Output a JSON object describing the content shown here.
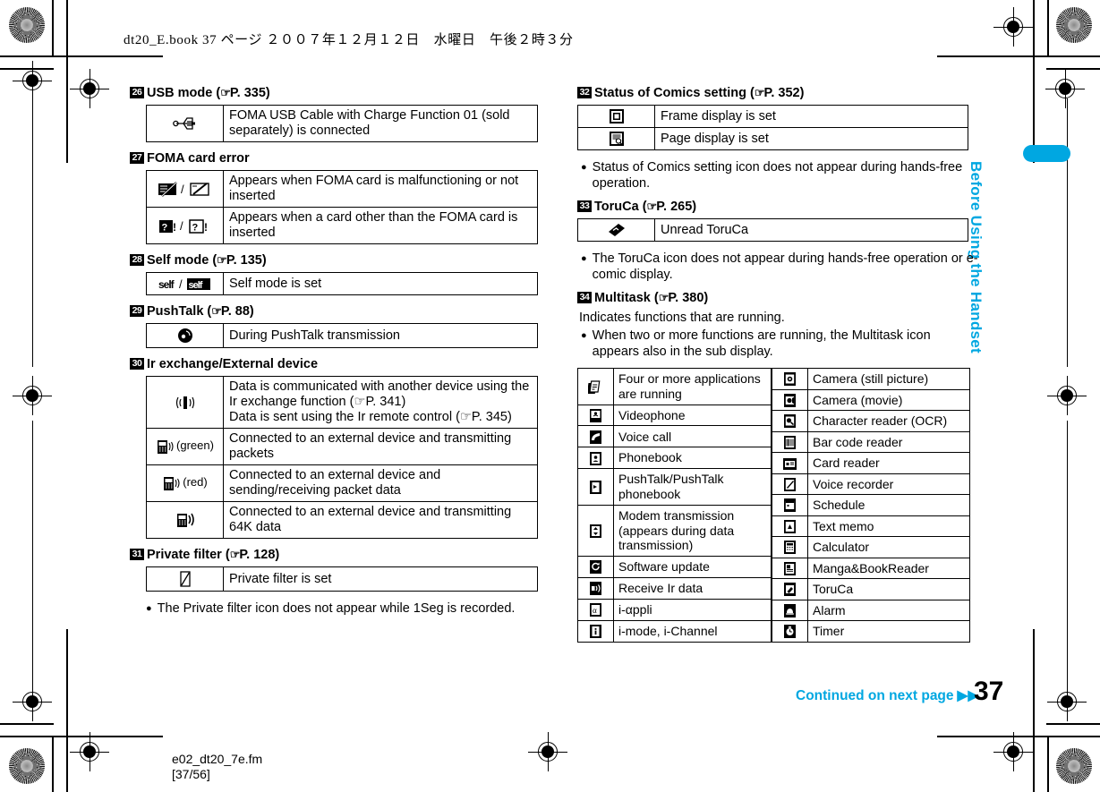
{
  "slug": {
    "header": "dt20_E.book  37 ページ  ２００７年１２月１２日　水曜日　午後２時３分",
    "footer_file": "e02_dt20_7e.fm",
    "footer_range": "[37/56]"
  },
  "side_tab": {
    "title": "Before Using the Handset",
    "color": "#00a7e1"
  },
  "footer": {
    "continued": "Continued on next page",
    "arrows": "▶▶",
    "page_number": "37"
  },
  "left_column": {
    "sections": [
      {
        "number": "26",
        "title": "USB mode",
        "ref": "P. 335",
        "rows": [
          {
            "icon": "usb-icon",
            "text": "FOMA USB Cable with Charge Function 01 (sold separately) is connected"
          }
        ]
      },
      {
        "number": "27",
        "title": "FOMA card error",
        "ref": "",
        "rows": [
          {
            "icon": "foma-card-error-icon",
            "text": "Appears when FOMA card is malfunctioning or not inserted"
          },
          {
            "icon": "other-card-icon",
            "text": "Appears when a card other than the FOMA card is inserted"
          }
        ]
      },
      {
        "number": "28",
        "title": "Self mode",
        "ref": "P. 135",
        "rows": [
          {
            "icon": "self-mode-icon",
            "text": "Self mode is set"
          }
        ]
      },
      {
        "number": "29",
        "title": "PushTalk",
        "ref": "P. 88",
        "rows": [
          {
            "icon": "pushtalk-icon",
            "text": "During PushTalk transmission"
          }
        ]
      },
      {
        "number": "30",
        "title": "Ir exchange/External device",
        "ref": "",
        "rows": [
          {
            "icon": "ir-exchange-icon",
            "text": "Data is communicated with another device using the Ir exchange function (☞P. 341)\nData is sent using the Ir remote control (☞P. 345)"
          },
          {
            "icon": "external-device-green-icon",
            "icon_label": "(green)",
            "text": "Connected to an external device and transmitting packets"
          },
          {
            "icon": "external-device-red-icon",
            "icon_label": "(red)",
            "text": "Connected to an external device and sending/receiving packet data"
          },
          {
            "icon": "external-device-64k-icon",
            "text": "Connected to an external device and transmitting 64K data"
          }
        ]
      },
      {
        "number": "31",
        "title": "Private filter",
        "ref": "P. 128",
        "rows": [
          {
            "icon": "private-filter-icon",
            "text": "Private filter is set"
          }
        ],
        "note": "The Private filter icon does not appear while 1Seg is recorded."
      }
    ]
  },
  "right_column": {
    "sections": [
      {
        "number": "32",
        "title": "Status of Comics setting",
        "ref": "P. 352",
        "rows": [
          {
            "icon": "frame-display-icon",
            "text": "Frame display is set"
          },
          {
            "icon": "page-display-icon",
            "text": "Page display is set"
          }
        ],
        "note": "Status of Comics setting icon does not appear during hands-free operation."
      },
      {
        "number": "33",
        "title": "ToruCa",
        "ref": "P. 265",
        "rows": [
          {
            "icon": "toruca-unread-icon",
            "text": "Unread ToruCa"
          }
        ],
        "note": "The ToruCa icon does not appear during hands-free operation or e-comic display."
      },
      {
        "number": "34",
        "title": "Multitask",
        "ref": "P. 380",
        "intro": "Indicates functions that are running.",
        "note": "When two or more functions are running, the Multitask icon appears also in the sub display."
      }
    ],
    "multitask_left": [
      {
        "icon": "four-apps-icon",
        "text": "Four or more applications are running"
      },
      {
        "icon": "videophone-icon",
        "text": "Videophone"
      },
      {
        "icon": "voice-call-icon",
        "text": "Voice call"
      },
      {
        "icon": "phonebook-icon",
        "text": "Phonebook"
      },
      {
        "icon": "pushtalk-book-icon",
        "text": "PushTalk/PushTalk phonebook"
      },
      {
        "icon": "modem-icon",
        "text": "Modem transmission (appears during data transmission)"
      },
      {
        "icon": "software-update-icon",
        "text": "Software update"
      },
      {
        "icon": "receive-ir-icon",
        "text": "Receive Ir data"
      },
      {
        "icon": "i-appli-icon",
        "text": "i-αppli"
      },
      {
        "icon": "i-mode-icon",
        "text": "i-mode, i-Channel"
      }
    ],
    "multitask_right": [
      {
        "icon": "camera-still-icon",
        "text": "Camera (still picture)"
      },
      {
        "icon": "camera-movie-icon",
        "text": "Camera (movie)"
      },
      {
        "icon": "ocr-icon",
        "text": "Character reader (OCR)"
      },
      {
        "icon": "barcode-icon",
        "text": "Bar code reader"
      },
      {
        "icon": "card-reader-icon",
        "text": "Card reader"
      },
      {
        "icon": "voice-recorder-icon",
        "text": "Voice recorder"
      },
      {
        "icon": "schedule-icon",
        "text": "Schedule"
      },
      {
        "icon": "text-memo-icon",
        "text": "Text memo"
      },
      {
        "icon": "calculator-icon",
        "text": "Calculator"
      },
      {
        "icon": "manga-reader-icon",
        "text": "Manga&BookReader"
      },
      {
        "icon": "toruca-icon",
        "text": "ToruCa"
      },
      {
        "icon": "alarm-icon",
        "text": "Alarm"
      },
      {
        "icon": "timer-icon",
        "text": "Timer"
      }
    ]
  }
}
